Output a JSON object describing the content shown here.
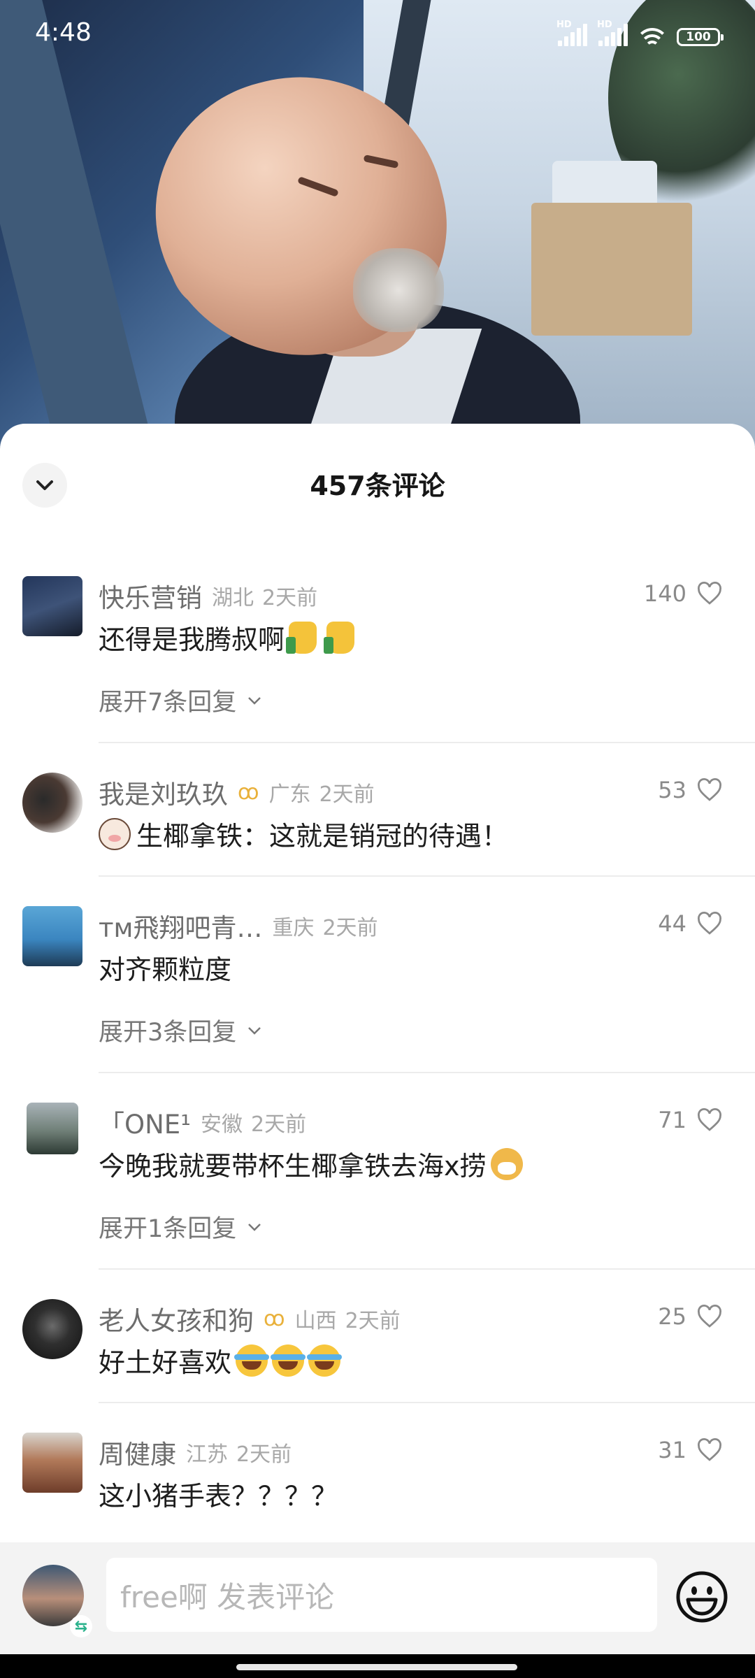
{
  "status_bar": {
    "time": "4:48",
    "signal_1_label": "HD",
    "signal_2_label": "HD",
    "battery": "100"
  },
  "sheet": {
    "title": "457条评论"
  },
  "comments": [
    {
      "name": "快乐营销",
      "badge": "",
      "location": "湖北",
      "time": "2天前",
      "text": "还得是我腾叔啊",
      "likes": "140",
      "expand": "展开7条回复"
    },
    {
      "name": "我是刘玖玖",
      "badge": "ꝏ",
      "location": "广东",
      "time": "2天前",
      "text": "生椰拿铁：这就是销冠的待遇！",
      "likes": "53",
      "expand": ""
    },
    {
      "name": "ᴛᴍ飛翔吧青…",
      "badge": "",
      "location": "重庆",
      "time": "2天前",
      "text": "对齐颗粒度",
      "likes": "44",
      "expand": "展开3条回复"
    },
    {
      "name": "「ONE¹",
      "badge": "",
      "location": "安徽",
      "time": "2天前",
      "text": "今晚我就要带杯生椰拿铁去海x捞",
      "likes": "71",
      "expand": "展开1条回复"
    },
    {
      "name": "老人女孩和狗",
      "badge": "ꝏ",
      "location": "山西",
      "time": "2天前",
      "text": "好土好喜欢",
      "likes": "25",
      "expand": ""
    },
    {
      "name": "周健康",
      "badge": "",
      "location": "江苏",
      "time": "2天前",
      "text": "这小猪手表？？？？",
      "likes": "31",
      "expand": ""
    }
  ],
  "input_bar": {
    "placeholder": "free啊 发表评论"
  },
  "icons": {
    "collapse": "chevron-down-icon",
    "like": "heart-outline-icon",
    "expand": "chevron-down-icon",
    "emoji": "smiley-icon",
    "switch": "switch-account-icon"
  },
  "colors": {
    "sheet_background": "#ffffff",
    "name_text": "#6d6d6d",
    "meta_text": "#a8a8a8",
    "badge": "#e9b13b"
  }
}
